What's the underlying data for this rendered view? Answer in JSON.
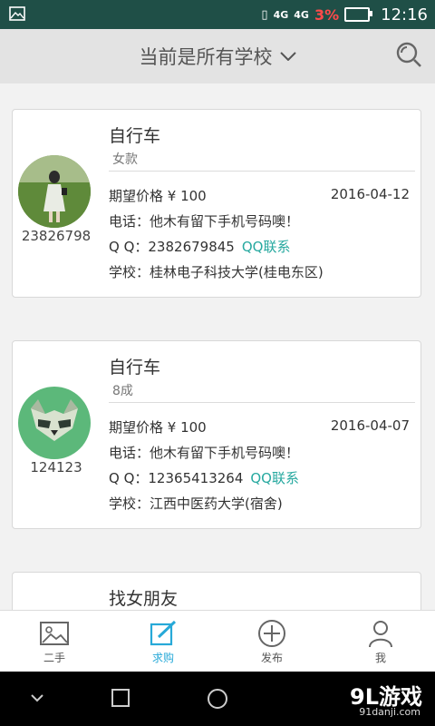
{
  "status": {
    "network": "4G",
    "network2": "4G",
    "battery_pct": "3%",
    "time": "12:16"
  },
  "header": {
    "title": "当前是所有学校"
  },
  "cards": [
    {
      "title": "自行车",
      "subtitle": "女款",
      "user_id": "23826798",
      "price": "期望价格 ¥ 100",
      "date": "2016-04-12",
      "phone": "电话：他木有留下手机号码噢！",
      "qq_label": "Q Q：",
      "qq": "2382679845",
      "qq_link": "QQ联系",
      "school": "学校：桂林电子科技大学(桂电东区)"
    },
    {
      "title": "自行车",
      "subtitle": "8成",
      "user_id": "124123",
      "price": "期望价格 ¥ 100",
      "date": "2016-04-07",
      "phone": "电话：他木有留下手机号码噢！",
      "qq_label": "Q Q：",
      "qq": "12365413264",
      "qq_link": "QQ联系",
      "school": "学校：江西中医药大学(宿舍)"
    },
    {
      "title": "找女朋友"
    }
  ],
  "tabs": [
    {
      "label": "二手",
      "icon": "image-icon"
    },
    {
      "label": "求购",
      "icon": "edit-icon"
    },
    {
      "label": "发布",
      "icon": "plus-circle-icon"
    },
    {
      "label": "我",
      "icon": "person-icon"
    }
  ],
  "watermark": {
    "main": "9L游戏",
    "sub": "91danji.com"
  },
  "colors": {
    "accent": "#27a9d8",
    "qq_link": "#27a9a0",
    "statusbar": "#1f4f47"
  }
}
